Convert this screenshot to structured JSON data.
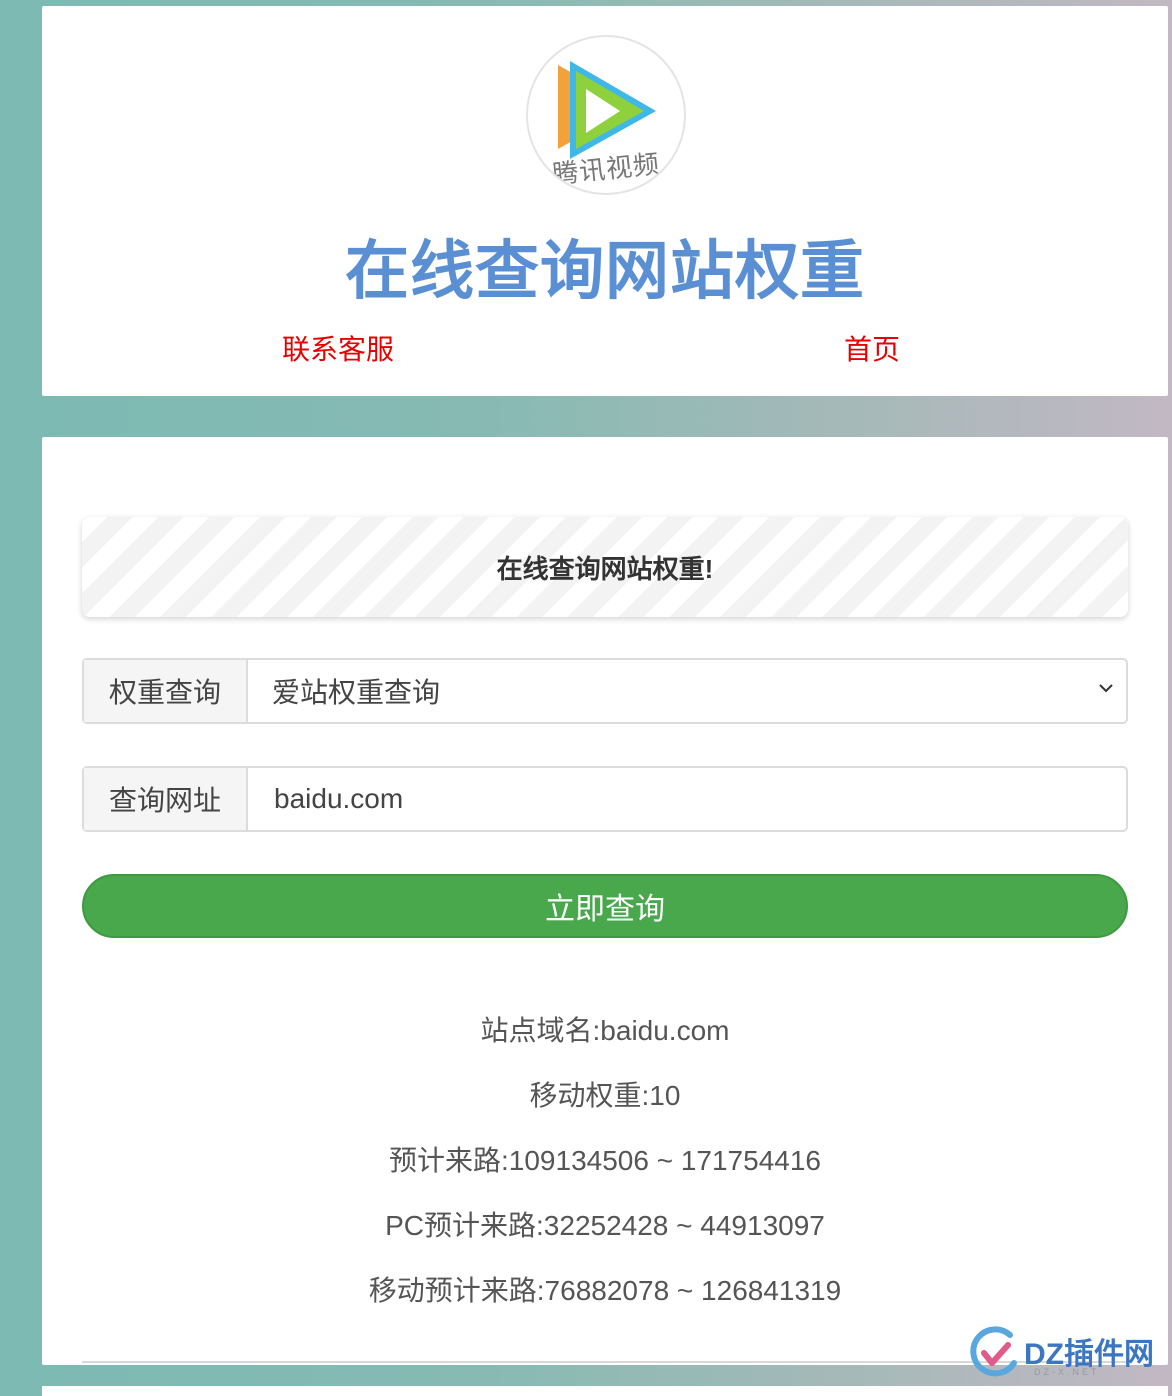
{
  "header": {
    "logo_text": "腾讯视频",
    "title": "在线查询网站权重",
    "nav": {
      "contact_label": "联系客服",
      "home_label": "首页"
    }
  },
  "main": {
    "notice_text": "在线查询网站权重!",
    "query_type": {
      "label": "权重查询",
      "selected_value": "爱站权重查询"
    },
    "url_field": {
      "label": "查询网址",
      "value": "baidu.com"
    },
    "submit_label": "立即查询",
    "results": [
      "站点域名:baidu.com",
      "移动权重:10",
      "预计来路:109134506 ~ 171754416",
      "PC预计来路:32252428 ~ 44913097",
      "移动预计来路:76882078 ~ 126841319"
    ]
  },
  "watermark": {
    "text": "DZ插件网",
    "sub": "DZ-X.NET"
  },
  "colors": {
    "title_blue": "#5b8fd4",
    "nav_red": "#e60000",
    "button_green": "#48a84b"
  }
}
